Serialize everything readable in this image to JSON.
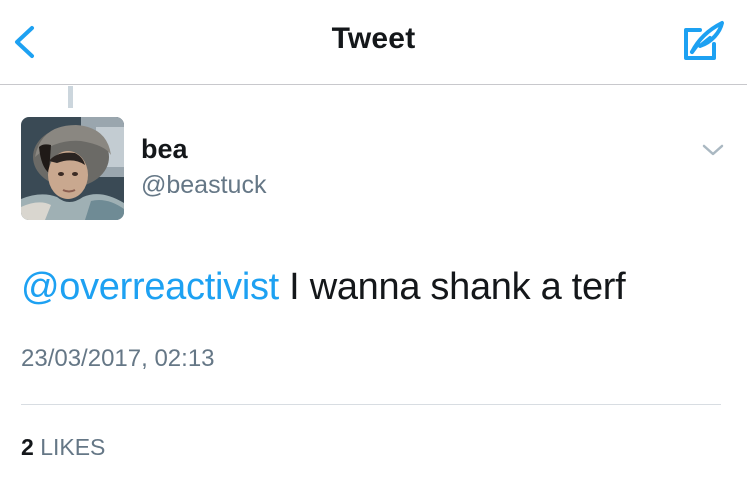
{
  "nav": {
    "title": "Tweet",
    "back_icon": "chevron-left-icon",
    "compose_icon": "compose-tweet-icon",
    "accent_color": "#1da1f2"
  },
  "tweet": {
    "author": {
      "display_name": "bea",
      "handle": "@beastuck",
      "avatar_icon": "avatar-photo"
    },
    "mention": "@overreactivist",
    "text": " I wanna shank a terf",
    "timestamp": "23/03/2017, 02:13",
    "likes_count": "2",
    "likes_label": "LIKES",
    "options_icon": "chevron-down-icon"
  }
}
